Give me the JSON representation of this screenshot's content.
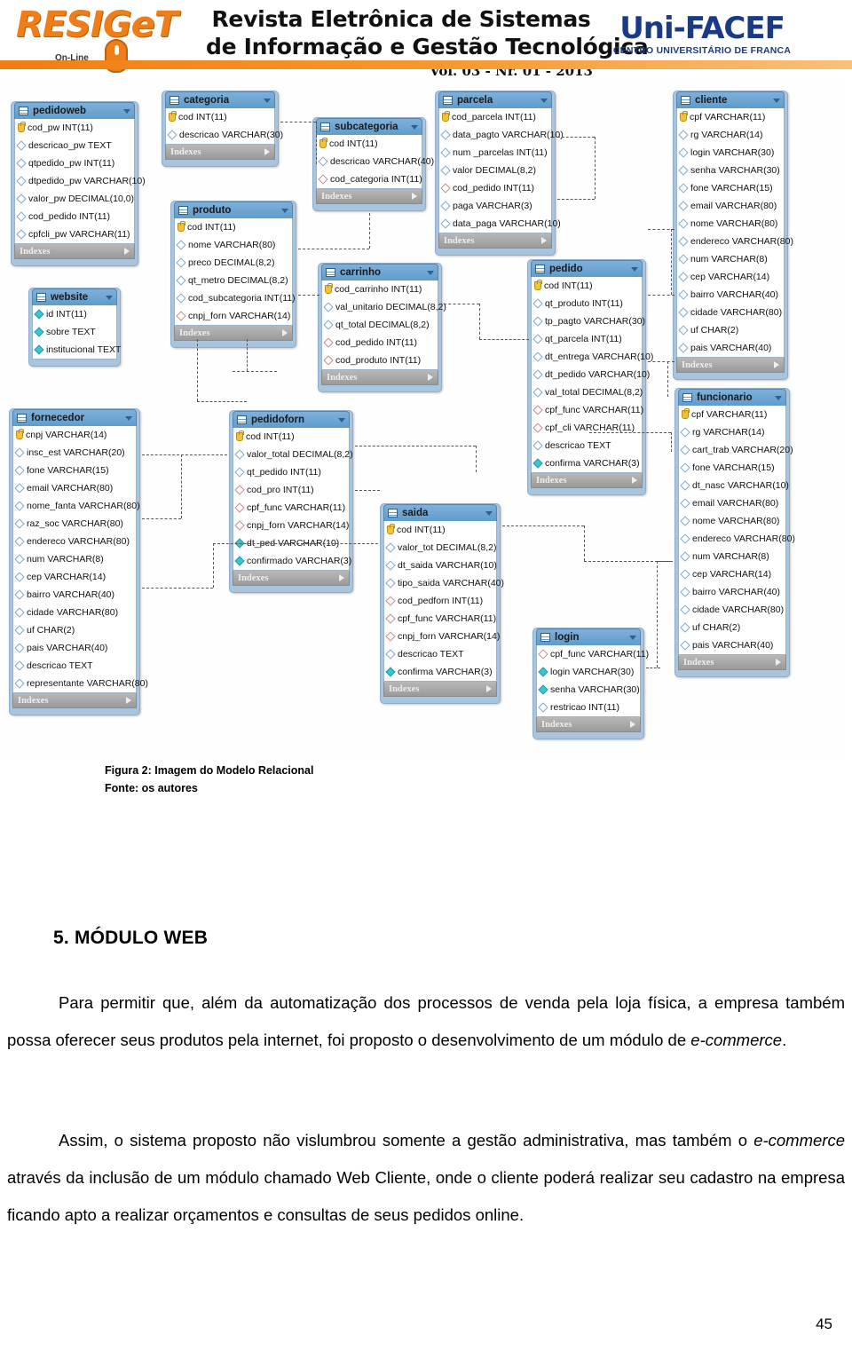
{
  "banner": {
    "logo_left_word": "RESIGeT",
    "logo_left_tag": "On-Line",
    "title_line1": "Revista Eletrônica de Sistemas",
    "title_line2": "de Informação e Gestão Tecnológica",
    "volume": "Vol. 03 - Nr. 01 - 2013",
    "logo_right_word": "Uni-FACEF",
    "logo_right_sub": "CENTRO UNIVERSITÁRIO DE FRANCA"
  },
  "diagram": {
    "indexes_label": "Indexes",
    "tables": [
      {
        "id": "pedidoweb",
        "name": "pedidoweb",
        "fields": [
          {
            "text": "cod_pw INT(11)",
            "kind": "pk"
          },
          {
            "text": "descricao_pw TEXT",
            "kind": "col"
          },
          {
            "text": "qtpedido_pw INT(11)",
            "kind": "col"
          },
          {
            "text": "dtpedido_pw VARCHAR(10)",
            "kind": "col"
          },
          {
            "text": "valor_pw DECIMAL(10,0)",
            "kind": "col"
          },
          {
            "text": "cod_pedido INT(11)",
            "kind": "col"
          },
          {
            "text": "cpfcli_pw VARCHAR(11)",
            "kind": "col"
          }
        ]
      },
      {
        "id": "website",
        "name": "website",
        "fields": [
          {
            "text": "id INT(11)",
            "kind": "nn"
          },
          {
            "text": "sobre TEXT",
            "kind": "nn"
          },
          {
            "text": "institucional TEXT",
            "kind": "nn"
          }
        ]
      },
      {
        "id": "categoria",
        "name": "categoria",
        "fields": [
          {
            "text": "cod INT(11)",
            "kind": "pk"
          },
          {
            "text": "descricao VARCHAR(30)",
            "kind": "col"
          }
        ]
      },
      {
        "id": "produto",
        "name": "produto",
        "fields": [
          {
            "text": "cod INT(11)",
            "kind": "pk"
          },
          {
            "text": "nome VARCHAR(80)",
            "kind": "col"
          },
          {
            "text": "preco DECIMAL(8,2)",
            "kind": "col"
          },
          {
            "text": "qt_metro DECIMAL(8,2)",
            "kind": "col"
          },
          {
            "text": "cod_subcategoria INT(11)",
            "kind": "col"
          },
          {
            "text": "cnpj_forn VARCHAR(14)",
            "kind": "fk"
          }
        ]
      },
      {
        "id": "subcategoria",
        "name": "subcategoria",
        "fields": [
          {
            "text": "cod INT(11)",
            "kind": "pk"
          },
          {
            "text": "descricao VARCHAR(40)",
            "kind": "col"
          },
          {
            "text": "cod_categoria INT(11)",
            "kind": "fk"
          }
        ]
      },
      {
        "id": "carrinho",
        "name": "carrinho",
        "fields": [
          {
            "text": "cod_carrinho INT(11)",
            "kind": "pk"
          },
          {
            "text": "val_unitario DECIMAL(8,2)",
            "kind": "col"
          },
          {
            "text": "qt_total DECIMAL(8,2)",
            "kind": "col"
          },
          {
            "text": "cod_pedido INT(11)",
            "kind": "fk"
          },
          {
            "text": "cod_produto INT(11)",
            "kind": "fk"
          }
        ]
      },
      {
        "id": "parcela",
        "name": "parcela",
        "fields": [
          {
            "text": "cod_parcela INT(11)",
            "kind": "pk"
          },
          {
            "text": "data_pagto VARCHAR(10)",
            "kind": "col"
          },
          {
            "text": "num _parcelas INT(11)",
            "kind": "col"
          },
          {
            "text": "valor DECIMAL(8,2)",
            "kind": "col"
          },
          {
            "text": "cod_pedido INT(11)",
            "kind": "fk"
          },
          {
            "text": "paga VARCHAR(3)",
            "kind": "col"
          },
          {
            "text": "data_paga VARCHAR(10)",
            "kind": "col"
          }
        ]
      },
      {
        "id": "pedido",
        "name": "pedido",
        "fields": [
          {
            "text": "cod INT(11)",
            "kind": "pk"
          },
          {
            "text": "qt_produto INT(11)",
            "kind": "col"
          },
          {
            "text": "tp_pagto VARCHAR(30)",
            "kind": "col"
          },
          {
            "text": "qt_parcela INT(11)",
            "kind": "col"
          },
          {
            "text": "dt_entrega VARCHAR(10)",
            "kind": "col"
          },
          {
            "text": "dt_pedido VARCHAR(10)",
            "kind": "col"
          },
          {
            "text": "val_total DECIMAL(8,2)",
            "kind": "col"
          },
          {
            "text": "cpf_func VARCHAR(11)",
            "kind": "fk"
          },
          {
            "text": "cpf_cli VARCHAR(11)",
            "kind": "fk"
          },
          {
            "text": "descricao TEXT",
            "kind": "col"
          },
          {
            "text": "confirma VARCHAR(3)",
            "kind": "nn"
          }
        ]
      },
      {
        "id": "cliente",
        "name": "cliente",
        "fields": [
          {
            "text": "cpf VARCHAR(11)",
            "kind": "pk"
          },
          {
            "text": "rg VARCHAR(14)",
            "kind": "col"
          },
          {
            "text": "login VARCHAR(30)",
            "kind": "col"
          },
          {
            "text": "senha VARCHAR(30)",
            "kind": "col"
          },
          {
            "text": "fone VARCHAR(15)",
            "kind": "col"
          },
          {
            "text": "email VARCHAR(80)",
            "kind": "col"
          },
          {
            "text": "nome VARCHAR(80)",
            "kind": "col"
          },
          {
            "text": "endereco VARCHAR(80)",
            "kind": "col"
          },
          {
            "text": "num VARCHAR(8)",
            "kind": "col"
          },
          {
            "text": "cep VARCHAR(14)",
            "kind": "col"
          },
          {
            "text": "bairro VARCHAR(40)",
            "kind": "col"
          },
          {
            "text": "cidade VARCHAR(80)",
            "kind": "col"
          },
          {
            "text": "uf CHAR(2)",
            "kind": "col"
          },
          {
            "text": "pais VARCHAR(40)",
            "kind": "col"
          }
        ]
      },
      {
        "id": "funcionario",
        "name": "funcionario",
        "fields": [
          {
            "text": "cpf VARCHAR(11)",
            "kind": "pk"
          },
          {
            "text": "rg VARCHAR(14)",
            "kind": "col"
          },
          {
            "text": "cart_trab VARCHAR(20)",
            "kind": "col"
          },
          {
            "text": "fone VARCHAR(15)",
            "kind": "col"
          },
          {
            "text": "dt_nasc VARCHAR(10)",
            "kind": "col"
          },
          {
            "text": "email VARCHAR(80)",
            "kind": "col"
          },
          {
            "text": "nome VARCHAR(80)",
            "kind": "col"
          },
          {
            "text": "endereco VARCHAR(80)",
            "kind": "col"
          },
          {
            "text": "num VARCHAR(8)",
            "kind": "col"
          },
          {
            "text": "cep VARCHAR(14)",
            "kind": "col"
          },
          {
            "text": "bairro VARCHAR(40)",
            "kind": "col"
          },
          {
            "text": "cidade VARCHAR(80)",
            "kind": "col"
          },
          {
            "text": "uf CHAR(2)",
            "kind": "col"
          },
          {
            "text": "pais VARCHAR(40)",
            "kind": "col"
          }
        ]
      },
      {
        "id": "fornecedor",
        "name": "fornecedor",
        "fields": [
          {
            "text": "cnpj VARCHAR(14)",
            "kind": "pk"
          },
          {
            "text": "insc_est VARCHAR(20)",
            "kind": "col"
          },
          {
            "text": "fone VARCHAR(15)",
            "kind": "col"
          },
          {
            "text": "email VARCHAR(80)",
            "kind": "col"
          },
          {
            "text": "nome_fanta VARCHAR(80)",
            "kind": "col"
          },
          {
            "text": "raz_soc VARCHAR(80)",
            "kind": "col"
          },
          {
            "text": "endereco VARCHAR(80)",
            "kind": "col"
          },
          {
            "text": "num VARCHAR(8)",
            "kind": "col"
          },
          {
            "text": "cep VARCHAR(14)",
            "kind": "col"
          },
          {
            "text": "bairro VARCHAR(40)",
            "kind": "col"
          },
          {
            "text": "cidade VARCHAR(80)",
            "kind": "col"
          },
          {
            "text": "uf CHAR(2)",
            "kind": "col"
          },
          {
            "text": "pais VARCHAR(40)",
            "kind": "col"
          },
          {
            "text": "descricao TEXT",
            "kind": "col"
          },
          {
            "text": "representante VARCHAR(80)",
            "kind": "col"
          }
        ]
      },
      {
        "id": "pedidoforn",
        "name": "pedidoforn",
        "fields": [
          {
            "text": "cod INT(11)",
            "kind": "pk"
          },
          {
            "text": "valor_total DECIMAL(8,2)",
            "kind": "col"
          },
          {
            "text": "qt_pedido INT(11)",
            "kind": "col"
          },
          {
            "text": "cod_pro INT(11)",
            "kind": "fk"
          },
          {
            "text": "cpf_func VARCHAR(11)",
            "kind": "fk"
          },
          {
            "text": "cnpj_forn VARCHAR(14)",
            "kind": "fk"
          },
          {
            "text": "dt_ped VARCHAR(10)",
            "kind": "nn"
          },
          {
            "text": "confirmado VARCHAR(3)",
            "kind": "nn"
          }
        ]
      },
      {
        "id": "saida",
        "name": "saida",
        "fields": [
          {
            "text": "cod INT(11)",
            "kind": "pk"
          },
          {
            "text": "valor_tot DECIMAL(8,2)",
            "kind": "col"
          },
          {
            "text": "dt_saida VARCHAR(10)",
            "kind": "col"
          },
          {
            "text": "tipo_saida VARCHAR(40)",
            "kind": "col"
          },
          {
            "text": "cod_pedforn INT(11)",
            "kind": "fk"
          },
          {
            "text": "cpf_func VARCHAR(11)",
            "kind": "fk"
          },
          {
            "text": "cnpj_forn VARCHAR(14)",
            "kind": "fk"
          },
          {
            "text": "descricao TEXT",
            "kind": "col"
          },
          {
            "text": "confirma VARCHAR(3)",
            "kind": "nn"
          }
        ]
      },
      {
        "id": "login",
        "name": "login",
        "fields": [
          {
            "text": "cpf_func VARCHAR(11)",
            "kind": "fk"
          },
          {
            "text": "login VARCHAR(30)",
            "kind": "nn"
          },
          {
            "text": "senha VARCHAR(30)",
            "kind": "nn"
          },
          {
            "text": "restricao INT(11)",
            "kind": "col"
          }
        ]
      }
    ]
  },
  "caption": {
    "line1": "Figura 2: Imagem do Modelo Relacional",
    "line2": "Fonte: os autores"
  },
  "section": {
    "title": "5. MÓDULO WEB"
  },
  "paragraphs": {
    "p1_a": "Para permitir que, além da automatização dos processos de venda pela loja física, a empresa também possa oferecer seus produtos pela internet, foi proposto o desenvolvimento de um módulo de ",
    "p1_em": "e-commerce",
    "p1_b": ".",
    "p2_a": "Assim, o sistema proposto não vislumbrou somente a gestão administrativa, mas também o ",
    "p2_em": "e-commerce",
    "p2_b": " através da inclusão de um módulo chamado Web Cliente, onde o cliente poderá realizar seu cadastro na empresa ficando apto a realizar orçamentos e consultas de seus pedidos online."
  },
  "page_number": "45"
}
